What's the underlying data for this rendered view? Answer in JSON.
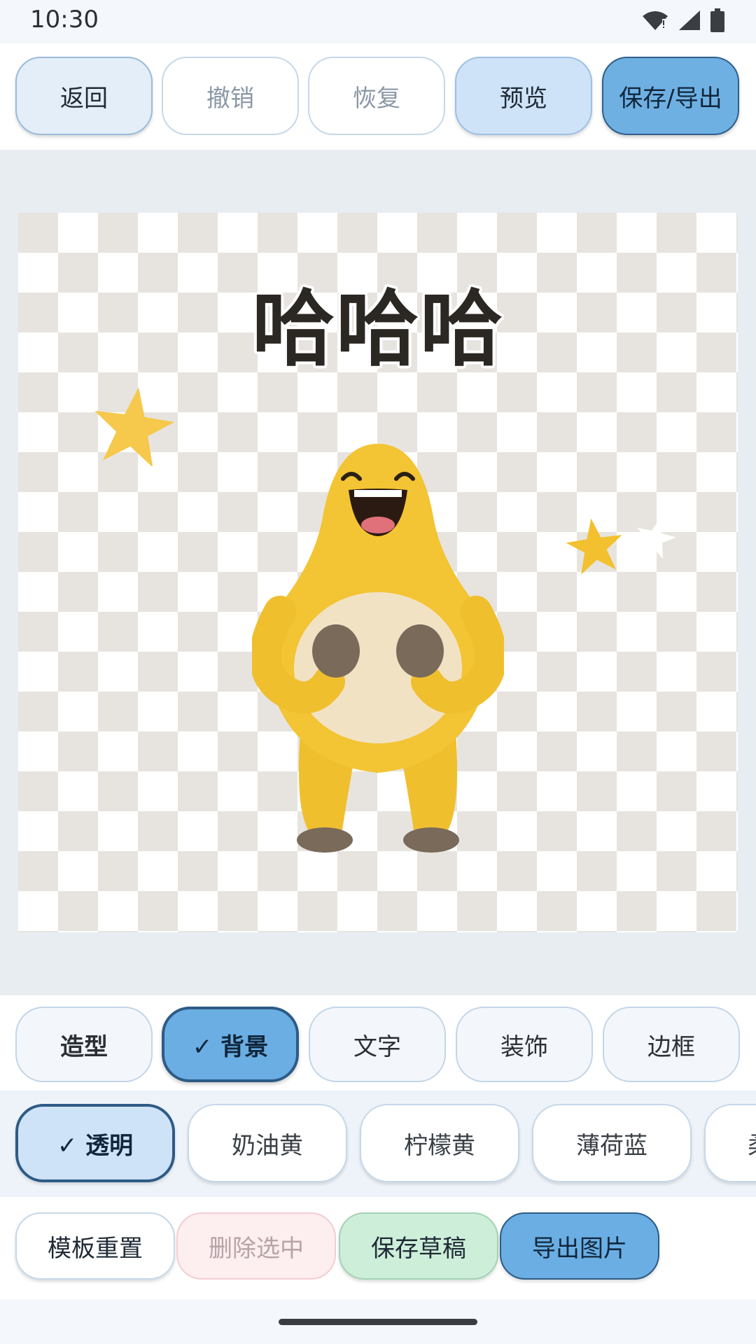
{
  "status_bar": {
    "time": "10:30",
    "icons": [
      "wifi-icon",
      "signal-icon",
      "battery-icon"
    ]
  },
  "toolbar": {
    "back_label": "返回",
    "undo_label": "撤销",
    "redo_label": "恢复",
    "preview_label": "预览",
    "save_export_label": "保存/导出"
  },
  "canvas": {
    "background": "透明",
    "meme_text": "哈哈哈",
    "stickers": [
      "star-icon",
      "star-icon",
      "star-icon",
      "laughing-yellow-character"
    ]
  },
  "categories": {
    "items": [
      {
        "label": "造型"
      },
      {
        "label": "✓ 背景",
        "selected": true
      },
      {
        "label": "文字"
      },
      {
        "label": "装饰"
      },
      {
        "label": "边框"
      }
    ]
  },
  "background_options": {
    "items": [
      {
        "label": "✓ 透明",
        "selected": true
      },
      {
        "label": "奶油黄"
      },
      {
        "label": "柠檬黄"
      },
      {
        "label": "薄荷蓝"
      },
      {
        "label": "柔"
      }
    ]
  },
  "actions": {
    "reset_label": "模板重置",
    "delete_label": "删除选中",
    "save_draft_label": "保存草稿",
    "export_label": "导出图片"
  },
  "colors": {
    "accent": "#6aaee3",
    "accent_border": "#2e5b86",
    "selected_light": "#cfe3f8",
    "draft_green": "#cdeed9",
    "delete_pink": "#fdeef0",
    "star_yellow": "#f6c84b",
    "character_yellow": "#f3c433"
  }
}
